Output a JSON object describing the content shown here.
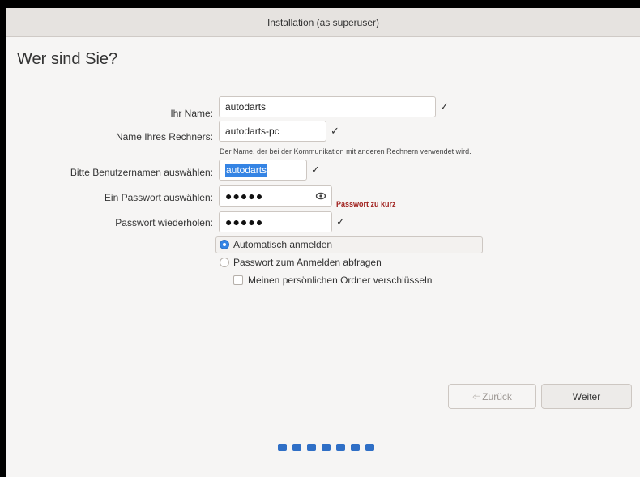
{
  "window": {
    "title": "Installation (as superuser)"
  },
  "page": {
    "title": "Wer sind Sie?"
  },
  "form": {
    "name": {
      "label": "Ihr Name:",
      "value": "autodarts",
      "check": "✓"
    },
    "computer": {
      "label": "Name Ihres Rechners:",
      "value": "autodarts-pc",
      "check": "✓",
      "hint": "Der Name, der bei der Kommunikation mit anderen Rechnern verwendet wird."
    },
    "username": {
      "label": "Bitte Benutzernamen auswählen:",
      "value": "autodarts",
      "check": "✓"
    },
    "password": {
      "label": "Ein Passwort auswählen:",
      "value": "●●●●●",
      "warning": "Passwort zu kurz"
    },
    "password_repeat": {
      "label": "Passwort wiederholen:",
      "value": "●●●●●",
      "check": "✓"
    }
  },
  "login_options": {
    "auto": {
      "label": "Automatisch anmelden",
      "selected": true
    },
    "ask_password": {
      "label": "Passwort zum Anmelden abfragen",
      "selected": false
    },
    "encrypt_home": {
      "label": "Meinen persönlichen Ordner verschlüsseln",
      "checked": false
    }
  },
  "buttons": {
    "back": "Zurück",
    "next": "Weiter"
  },
  "progress": {
    "steps": 7
  },
  "colors": {
    "accent": "#3584e4",
    "warning": "#a0211e",
    "progress": "#2f6fc6"
  }
}
